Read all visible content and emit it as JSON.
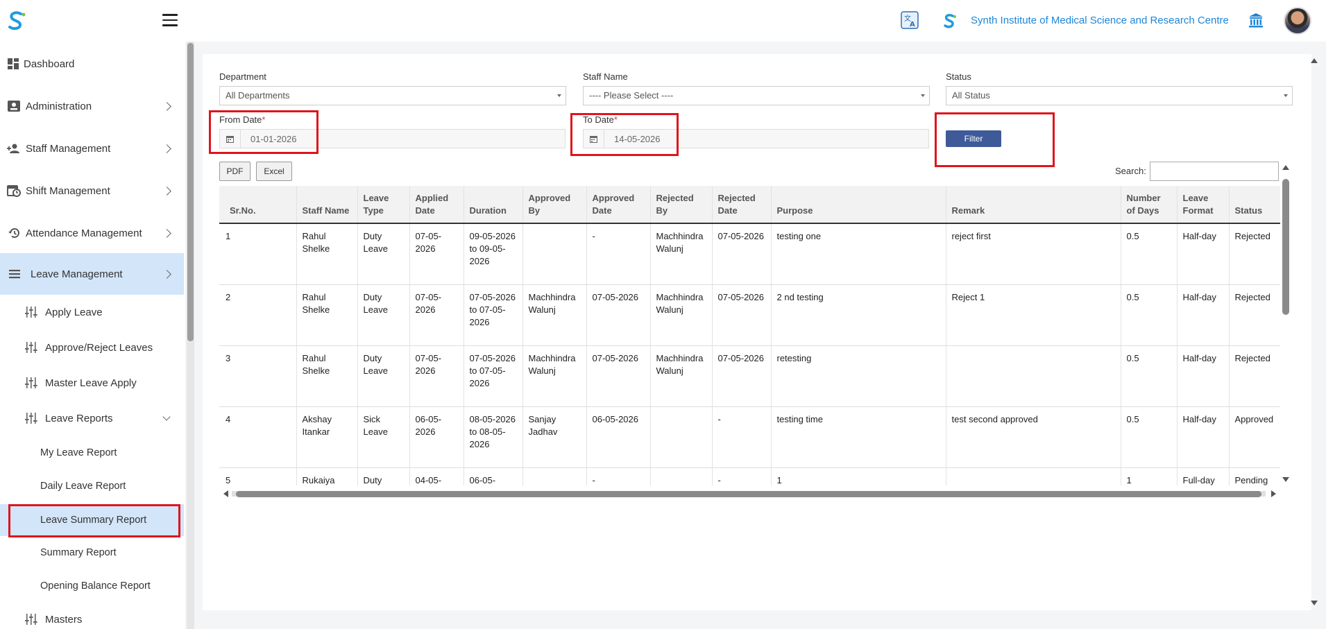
{
  "header": {
    "institute_name": "Synth Institute of Medical Science and Research Centre",
    "logo_icon": "s-logo-icon",
    "translate_icon": "translate-icon",
    "bank_icon": "institution-icon"
  },
  "sidebar": {
    "items": [
      {
        "label": "Dashboard",
        "icon": "dashboard-icon"
      },
      {
        "label": "Administration",
        "icon": "id-card-icon"
      },
      {
        "label": "Staff Management",
        "icon": "users-icon"
      },
      {
        "label": "Shift Management",
        "icon": "calendar-clock-icon"
      },
      {
        "label": "Attendance Management",
        "icon": "history-icon"
      },
      {
        "label": "Leave Management",
        "icon": "list-icon"
      }
    ],
    "leave_sub": [
      {
        "label": "Apply Leave",
        "icon": "sliders-icon"
      },
      {
        "label": "Approve/Reject Leaves",
        "icon": "sliders-icon"
      },
      {
        "label": "Master Leave Apply",
        "icon": "sliders-icon"
      },
      {
        "label": "Leave Reports",
        "icon": "sliders-icon"
      }
    ],
    "reports_sub": [
      {
        "label": "My Leave Report"
      },
      {
        "label": "Daily Leave Report"
      },
      {
        "label": "Leave Summary Report"
      },
      {
        "label": "Summary Report"
      },
      {
        "label": "Opening Balance Report"
      }
    ],
    "masters": {
      "label": "Masters",
      "icon": "sliders-icon"
    }
  },
  "filters": {
    "department_label": "Department",
    "department_value": "All Departments",
    "staff_label": "Staff Name",
    "staff_value": "---- Please Select ----",
    "status_label": "Status",
    "status_value": "All Status",
    "from_label": "From Date",
    "from_value": "01-01-2026",
    "to_label": "To Date",
    "to_value": "14-05-2026",
    "required_mark": "*",
    "filter_button": "Filter"
  },
  "toolbar": {
    "pdf": "PDF",
    "excel": "Excel",
    "search_label": "Search:"
  },
  "table": {
    "headers": [
      "Sr.No.",
      "Staff Name",
      "Leave Type",
      "Applied Date",
      "Duration",
      "Approved By",
      "Approved Date",
      "Rejected By",
      "Rejected Date",
      "Purpose",
      "Remark",
      "Number of Days",
      "Leave Format",
      "Status"
    ],
    "rows": [
      [
        "1",
        "Rahul Shelke",
        "Duty Leave",
        "07-05-2026",
        "09-05-2026 to 09-05-2026",
        "",
        "-",
        "Machhindra Walunj",
        "07-05-2026",
        "testing one",
        "reject first",
        "0.5",
        "Half-day",
        "Rejected"
      ],
      [
        "2",
        "Rahul Shelke",
        "Duty Leave",
        "07-05-2026",
        "07-05-2026 to 07-05-2026",
        "Machhindra Walunj",
        "07-05-2026",
        "Machhindra Walunj",
        "07-05-2026",
        "2 nd testing",
        "Reject 1",
        "0.5",
        "Half-day",
        "Rejected"
      ],
      [
        "3",
        "Rahul Shelke",
        "Duty Leave",
        "07-05-2026",
        "07-05-2026 to 07-05-2026",
        "Machhindra Walunj",
        "07-05-2026",
        "Machhindra Walunj",
        "07-05-2026",
        "retesting",
        "",
        "0.5",
        "Half-day",
        "Rejected"
      ],
      [
        "4",
        "Akshay Itankar",
        "Sick Leave",
        "06-05-2026",
        "08-05-2026 to 08-05-2026",
        "Sanjay Jadhav",
        "06-05-2026",
        "",
        "-",
        "testing time",
        "test second approved",
        "0.5",
        "Half-day",
        "Approved"
      ],
      [
        "5",
        "Rukaiya",
        "Duty",
        "04-05-",
        "06-05-",
        "",
        "-",
        "",
        "-",
        "1",
        "",
        "1",
        "Full-day",
        "Pending"
      ]
    ]
  }
}
